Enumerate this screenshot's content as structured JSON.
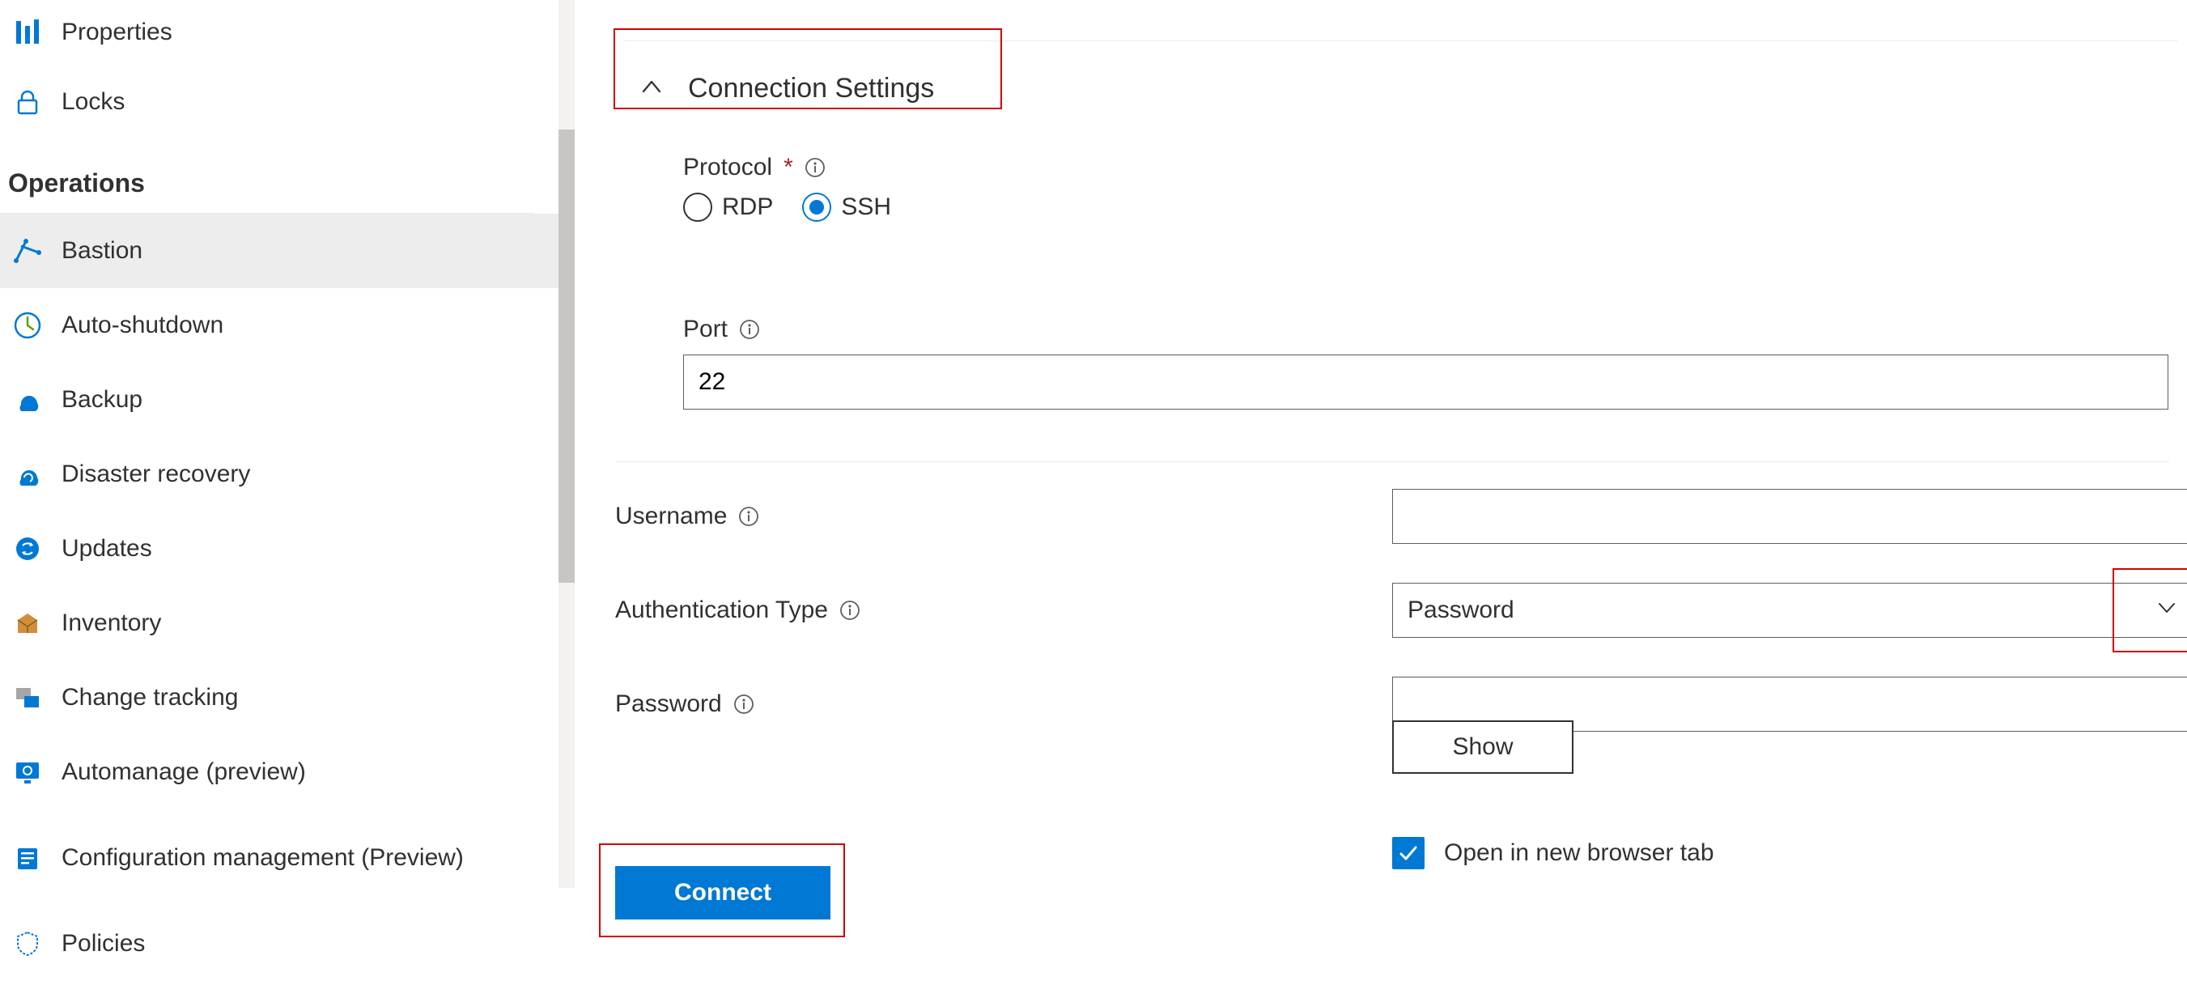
{
  "sidebar": {
    "properties": "Properties",
    "locks": "Locks",
    "section_operations": "Operations",
    "bastion": "Bastion",
    "auto_shutdown": "Auto-shutdown",
    "backup": "Backup",
    "disaster_recovery": "Disaster recovery",
    "updates": "Updates",
    "inventory": "Inventory",
    "change_tracking": "Change tracking",
    "automanage": "Automanage (preview)",
    "config_mgmt": "Configuration management (Preview)",
    "policies": "Policies"
  },
  "main": {
    "section_title": "Connection Settings",
    "protocol_label": "Protocol",
    "protocol_rdp": "RDP",
    "protocol_ssh": "SSH",
    "port_label": "Port",
    "port_value": "22",
    "username_label": "Username",
    "username_value": "",
    "auth_type_label": "Authentication Type",
    "auth_type_value": "Password",
    "password_label": "Password",
    "password_value": "",
    "show_button": "Show",
    "open_new_tab": "Open in new browser tab",
    "connect_button": "Connect"
  }
}
